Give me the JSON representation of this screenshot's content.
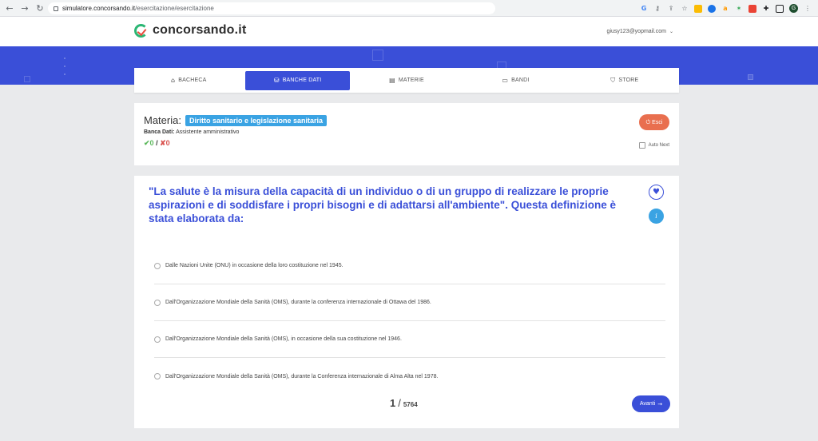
{
  "browser": {
    "url_host": "simulatore.concorsando.it",
    "url_path": "/esercitazione/esercitazione"
  },
  "header": {
    "logo_text": "concorsando.it",
    "user_email": "giusy123@yopmail.com",
    "profile_initial": "G"
  },
  "nav": {
    "tabs": [
      {
        "label": "BACHECA",
        "icon": "home-icon"
      },
      {
        "label": "BANCHE DATI",
        "icon": "database-icon"
      },
      {
        "label": "MATERIE",
        "icon": "book-icon"
      },
      {
        "label": "BANDI",
        "icon": "newspaper-icon"
      },
      {
        "label": "STORE",
        "icon": "shopping-bag-icon"
      }
    ],
    "active_index": 1
  },
  "subject": {
    "materia_label": "Materia:",
    "materia_value": "Diritto sanitario e legislazione sanitaria",
    "banca_label": "Banca Dati:",
    "banca_value": "Assistente amministrativo",
    "correct": "✔0",
    "separator": "/",
    "wrong": "✘0",
    "exit_label": "Esci",
    "autonext_label": "Auto Next"
  },
  "question": {
    "text": "\"La salute è la misura della capacità di un individuo o di un gruppo di realizzare le proprie aspirazioni e di soddisfare i propri bisogni e di adattarsi all'ambiente\". Questa definizione è stata elaborata da:",
    "answers": [
      "Dalle Nazioni Unite (ONU) in occasione della loro costituzione nel 1945.",
      "Dall'Organizzazione Mondiale della Sanità (OMS), durante la conferenza internazionale di Ottawa del 1986.",
      "Dall'Organizzazione Mondiale della Sanità (OMS), in occasione della sua costituzione nel 1946.",
      "Dall'Organizzazione Mondiale della Sanità (OMS), durante la Conferenza internazionale di Alma Alta nel 1978."
    ],
    "info_label": "i"
  },
  "pager": {
    "current": "1",
    "separator": "/",
    "total": "5764",
    "next_label": "Avanti"
  },
  "colors": {
    "primary": "#3a4fd8",
    "accent": "#3aa3e3",
    "exit": "#e96f4f",
    "success": "#5cb85c",
    "danger": "#d9534f"
  }
}
